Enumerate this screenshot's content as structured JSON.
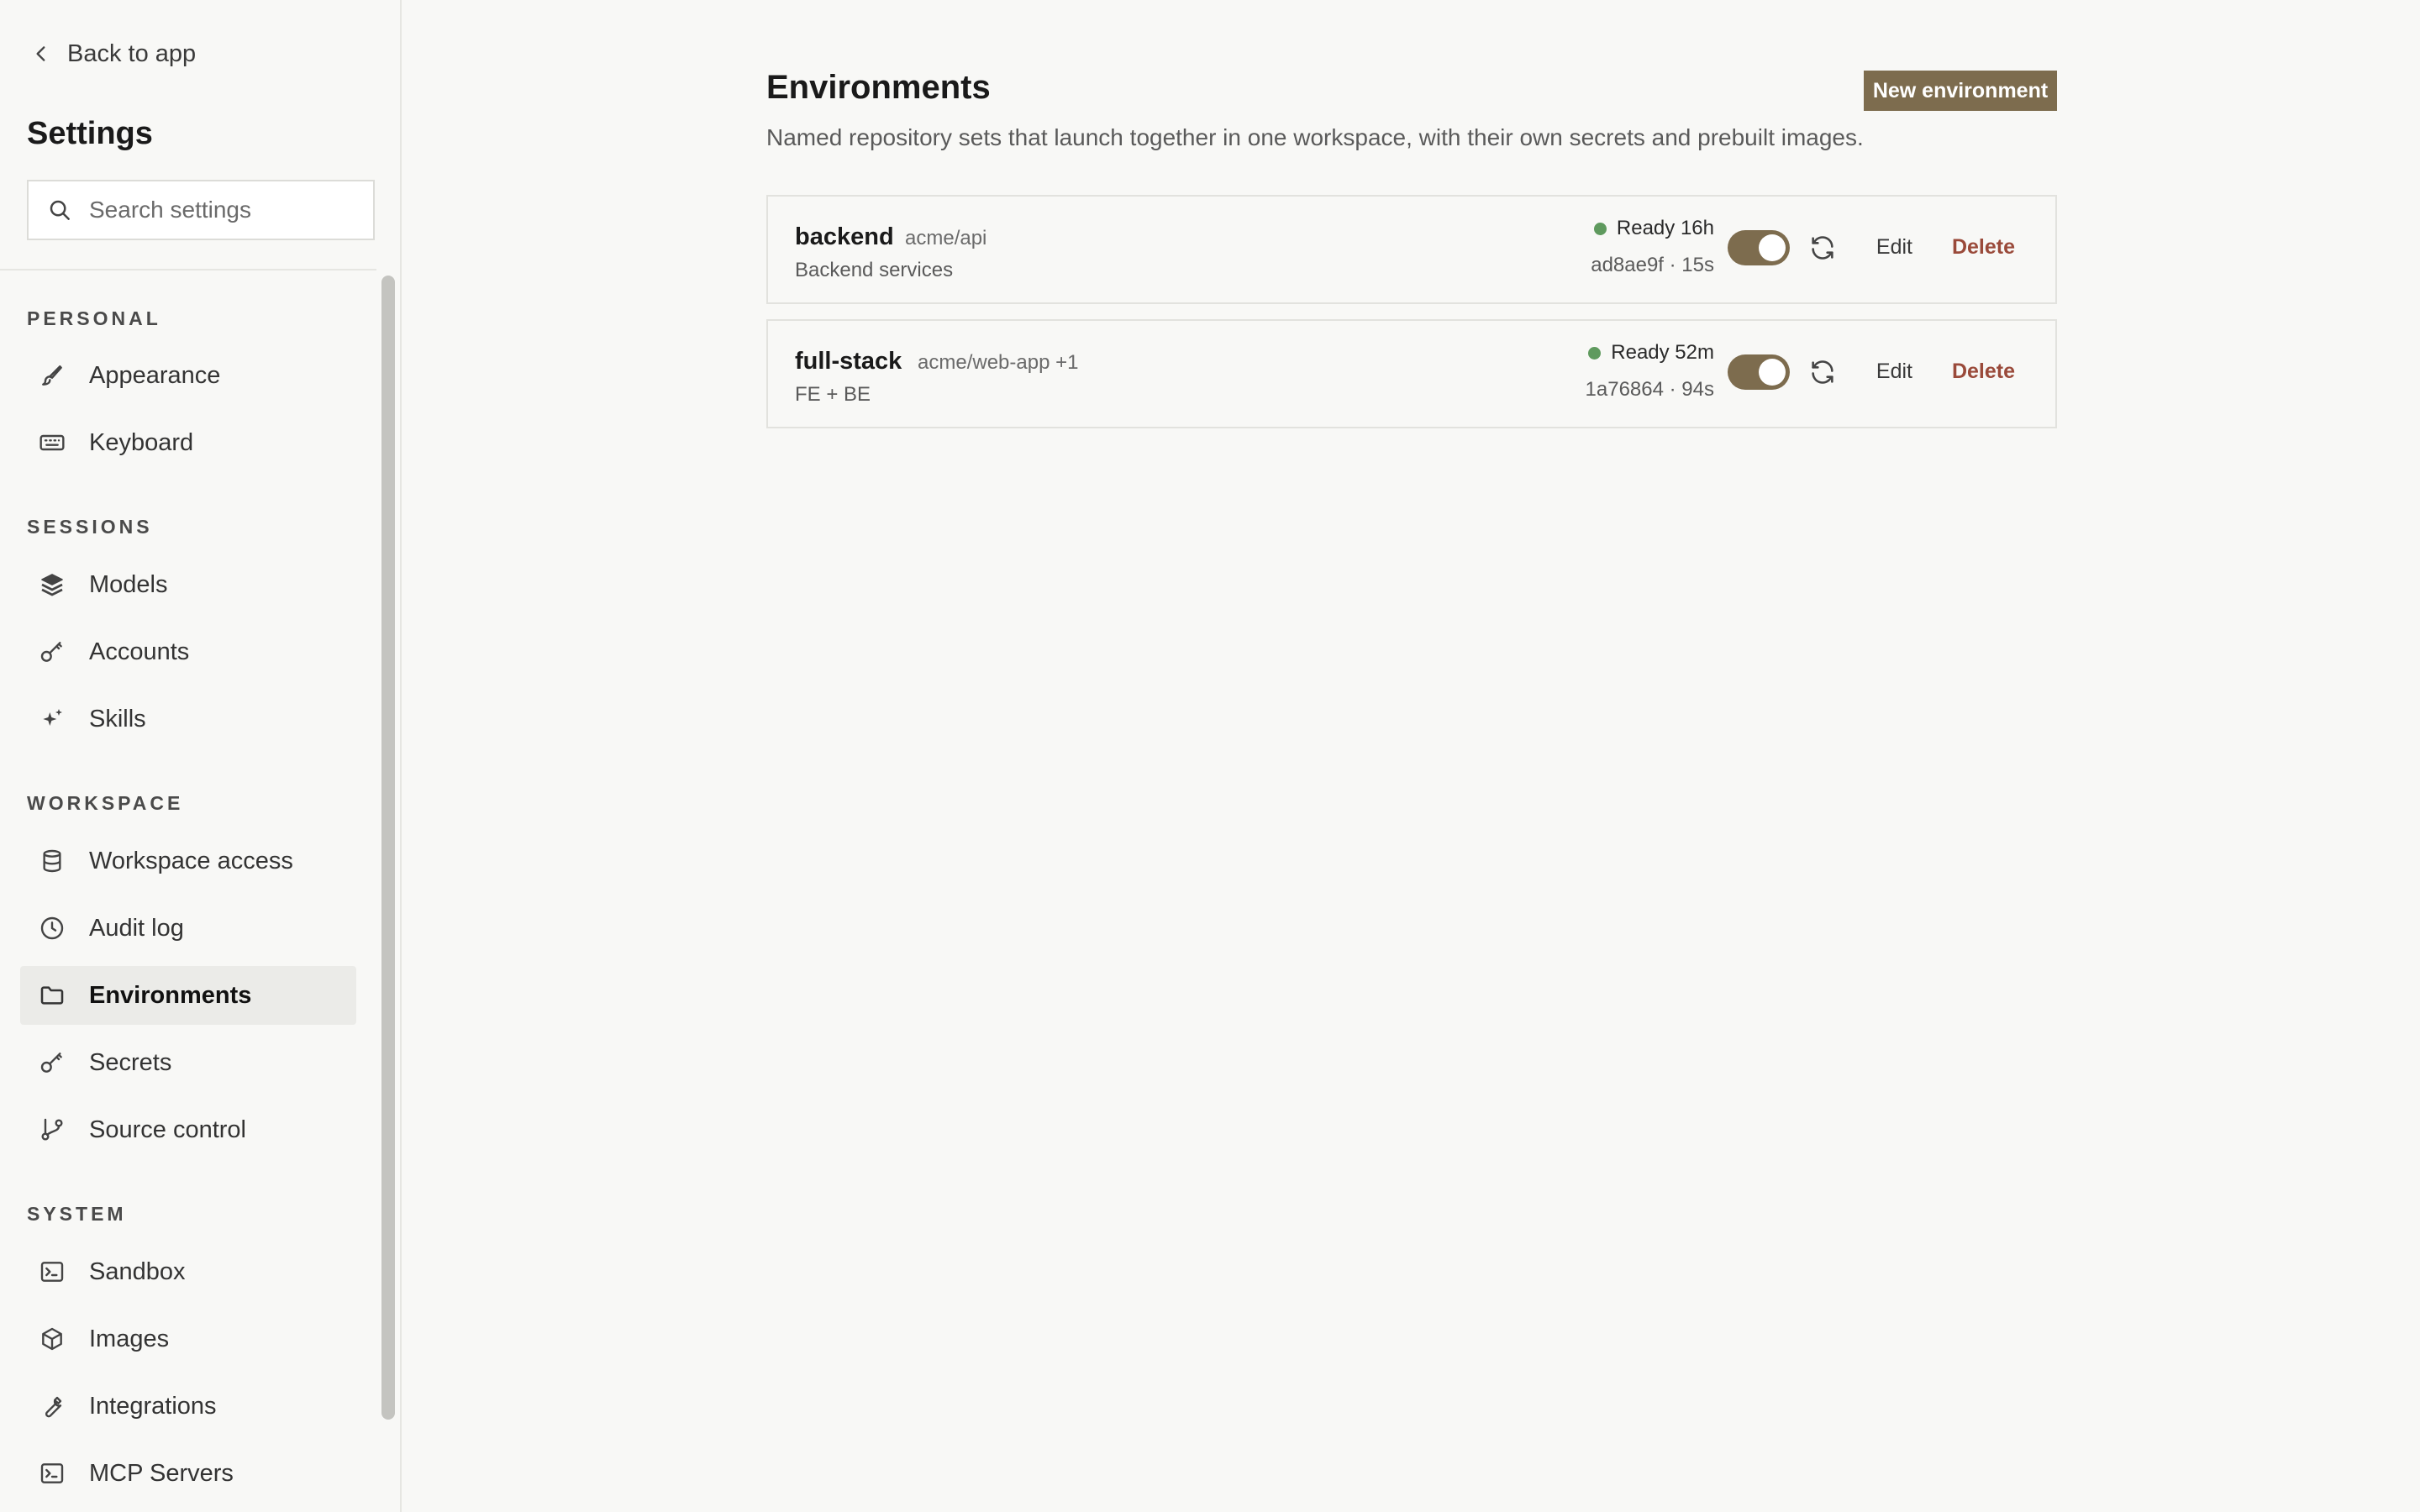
{
  "sidebar": {
    "back_label": "Back to app",
    "title": "Settings",
    "search_placeholder": "Search settings",
    "sections": {
      "personal": "PERSONAL",
      "sessions": "SESSIONS",
      "workspace": "WORKSPACE",
      "system": "SYSTEM"
    },
    "items": {
      "appearance": "Appearance",
      "keyboard": "Keyboard",
      "models": "Models",
      "accounts": "Accounts",
      "skills": "Skills",
      "workspace_access": "Workspace access",
      "audit_log": "Audit log",
      "environments": "Environments",
      "secrets": "Secrets",
      "source_control": "Source control",
      "sandbox": "Sandbox",
      "images": "Images",
      "integrations": "Integrations",
      "mcp_servers": "MCP Servers"
    },
    "active_item": "environments"
  },
  "main": {
    "title": "Environments",
    "description": "Named repository sets that launch together in one workspace, with their own secrets and prebuilt images.",
    "new_button": "New environment",
    "environments": [
      {
        "name": "backend",
        "repo": "acme/api",
        "description": "Backend services",
        "status": "Ready 16h",
        "meta": "ad8ae9f · 15s",
        "enabled": true,
        "edit_label": "Edit",
        "delete_label": "Delete"
      },
      {
        "name": "full-stack",
        "repo": "acme/web-app +1",
        "description": "FE + BE",
        "status": "Ready 52m",
        "meta": "1a76864 · 94s",
        "enabled": true,
        "edit_label": "Edit",
        "delete_label": "Delete"
      }
    ]
  },
  "colors": {
    "accent": "#7d6c4e",
    "status_ready": "#5f9a5e",
    "danger": "#9a4a3a"
  }
}
